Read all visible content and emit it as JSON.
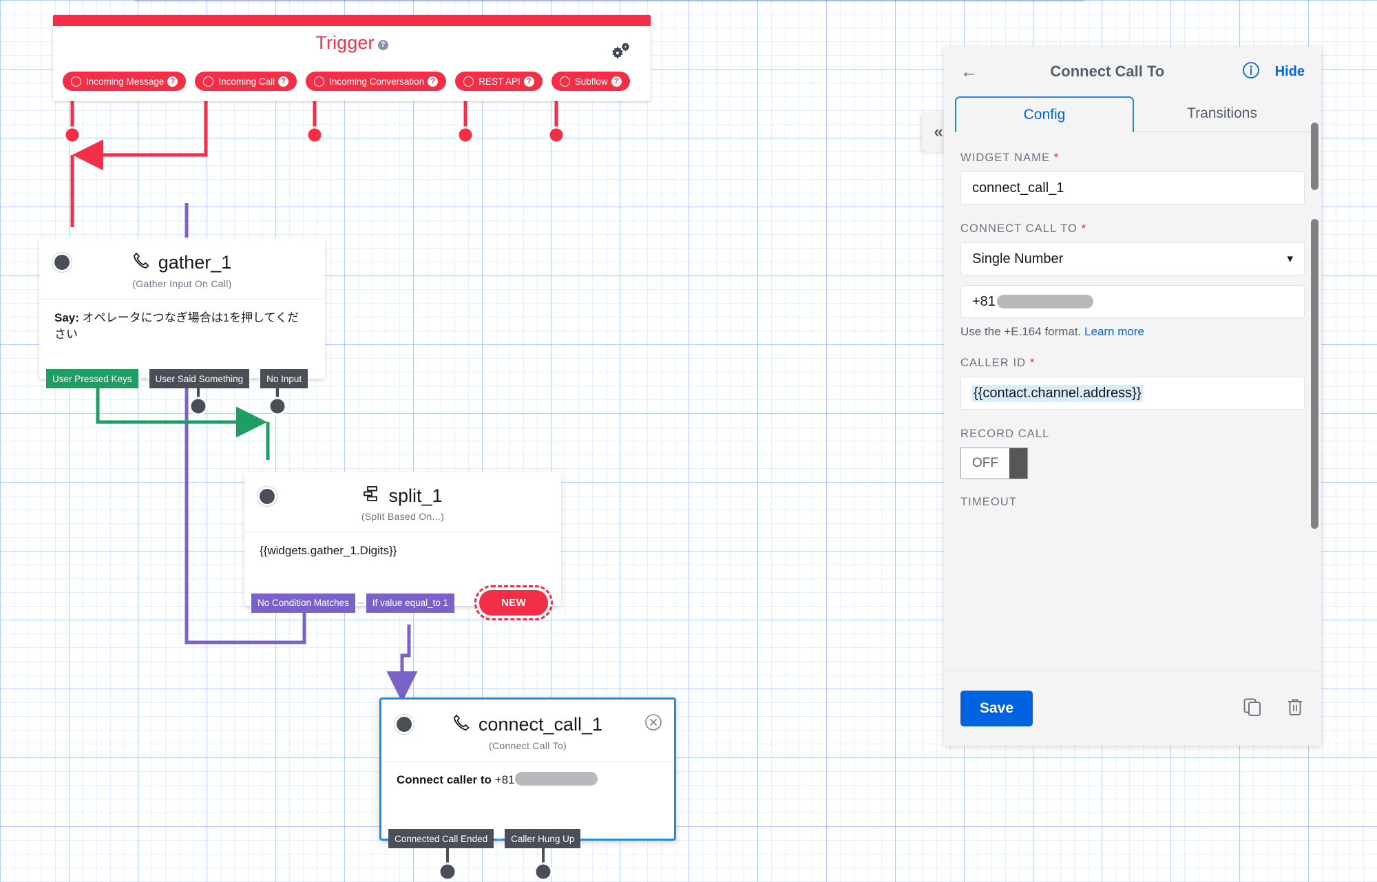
{
  "trigger": {
    "title": "Trigger",
    "gear_icon": "gears-icon",
    "help_icon": "question-mark-icon",
    "pills": [
      {
        "label": "Incoming Message",
        "icon": "circle-outline-icon"
      },
      {
        "label": "Incoming Call",
        "icon": "circle-outline-icon"
      },
      {
        "label": "Incoming Conversation",
        "icon": "circle-outline-icon"
      },
      {
        "label": "REST API",
        "icon": "circle-outline-icon"
      },
      {
        "label": "Subflow",
        "icon": "circle-outline-icon"
      }
    ]
  },
  "widgets": {
    "gather": {
      "name": "gather_1",
      "icon": "phone-handset-icon",
      "type": "(Gather Input On Call)",
      "body_label": "Say:",
      "body_text": "オペレータにつなぎ場合は1を押してください",
      "tags": [
        {
          "label": "User Pressed Keys",
          "color": "green"
        },
        {
          "label": "User Said Something",
          "color": "gray"
        },
        {
          "label": "No Input",
          "color": "gray"
        }
      ]
    },
    "split": {
      "name": "split_1",
      "icon": "split-branch-icon",
      "type": "(Split Based On...)",
      "body_text": "{{widgets.gather_1.Digits}}",
      "tags": [
        {
          "label": "No Condition Matches",
          "color": "purple"
        },
        {
          "label": "If value equal_to 1",
          "color": "purple"
        }
      ],
      "new_label": "NEW"
    },
    "connect_call": {
      "name": "connect_call_1",
      "icon": "phone-handset-icon",
      "type": "(Connect Call To)",
      "body_label": "Connect caller to",
      "body_text": "+81",
      "close_icon": "close-circle-icon",
      "tags": [
        {
          "label": "Connected Call Ended",
          "color": "gray"
        },
        {
          "label": "Caller Hung Up",
          "color": "gray"
        }
      ]
    }
  },
  "panel": {
    "back_icon": "back-arrow-icon",
    "title": "Connect Call To",
    "info_icon": "info-circle-icon",
    "hide_label": "Hide",
    "collapse_icon": "double-chevron-left-icon",
    "tabs": [
      {
        "label": "Config",
        "active": true
      },
      {
        "label": "Transitions",
        "active": false
      }
    ],
    "fields": {
      "widget_name": {
        "label": "WIDGET NAME",
        "required": true,
        "value": "connect_call_1"
      },
      "connect_call_to": {
        "label": "CONNECT CALL TO",
        "required": true,
        "value": "Single Number",
        "options": [
          "Single Number"
        ],
        "chevron_icon": "chevron-down-icon"
      },
      "number": {
        "value": "+81",
        "help_text": "Use the +E.164 format.",
        "help_link": "Learn more"
      },
      "caller_id": {
        "label": "CALLER ID",
        "required": true,
        "value": "{{contact.channel.address}}"
      },
      "record_call": {
        "label": "RECORD CALL",
        "value": "OFF"
      },
      "timeout": {
        "label": "TIMEOUT"
      }
    },
    "footer": {
      "save_label": "Save",
      "copy_icon": "copy-icon",
      "delete_icon": "trash-icon"
    }
  },
  "colors": {
    "brand_red": "#f22f46",
    "accent_blue": "#0263e0",
    "green": "#1e9e62",
    "purple": "#7b62c9",
    "gray_tag": "#4a4f57",
    "selection_blue": "#1f8ddb"
  }
}
